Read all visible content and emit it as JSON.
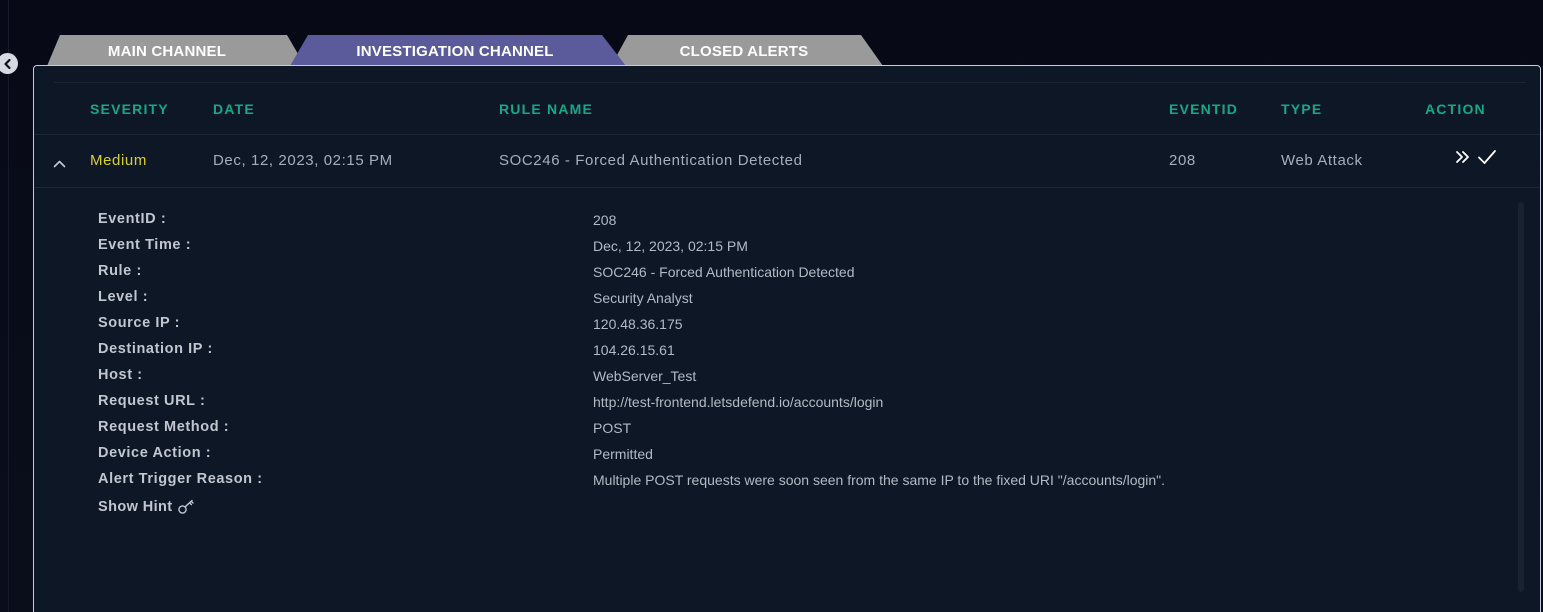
{
  "tabs": {
    "main": "MAIN CHANNEL",
    "investigation": "INVESTIGATION CHANNEL",
    "closed": "CLOSED ALERTS",
    "active": "INVESTIGATION CHANNEL"
  },
  "table": {
    "headers": {
      "severity": "SEVERITY",
      "date": "DATE",
      "rule_name": "RULE NAME",
      "eventid": "EVENTID",
      "type": "TYPE",
      "action": "ACTION"
    },
    "row": {
      "severity": "Medium",
      "date": "Dec, 12, 2023, 02:15 PM",
      "rule_name": "SOC246 - Forced Authentication Detected",
      "eventid": "208",
      "type": "Web Attack"
    }
  },
  "details": {
    "fields": [
      {
        "label": "EventID :",
        "value": "208"
      },
      {
        "label": "Event Time :",
        "value": "Dec, 12, 2023, 02:15 PM"
      },
      {
        "label": "Rule :",
        "value": "SOC246 - Forced Authentication Detected"
      },
      {
        "label": "Level :",
        "value": "Security Analyst"
      },
      {
        "label": "Source IP :",
        "value": "120.48.36.175"
      },
      {
        "label": "Destination IP :",
        "value": "104.26.15.61"
      },
      {
        "label": "Host :",
        "value": "WebServer_Test"
      },
      {
        "label": "Request URL :",
        "value": "http://test-frontend.letsdefend.io/accounts/login"
      },
      {
        "label": "Request Method :",
        "value": "POST"
      },
      {
        "label": "Device Action :",
        "value": "Permitted"
      },
      {
        "label": "Alert Trigger Reason :",
        "value": "Multiple POST requests were soon seen from the same IP to the fixed URI \"/accounts/login\"."
      }
    ],
    "show_hint": "Show Hint"
  },
  "colors": {
    "accent_teal": "#13a88a",
    "severity_medium": "#d9d12a",
    "tab_active": "#5b5b9c",
    "tab_inactive": "#9a9a9a"
  }
}
